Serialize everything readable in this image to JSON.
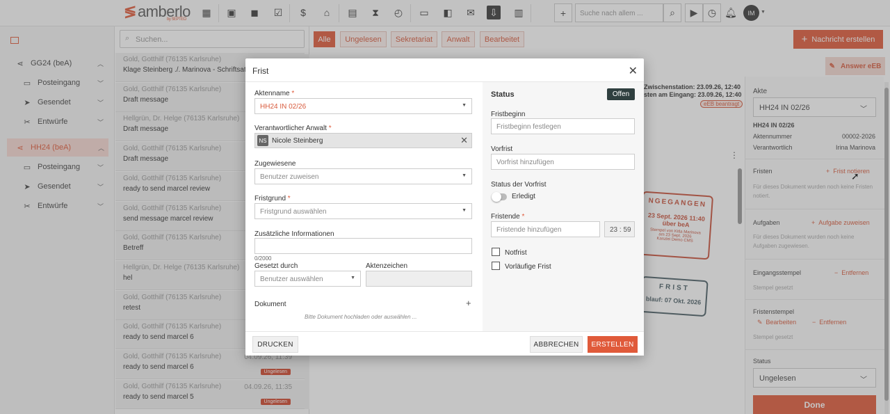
{
  "topbar": {
    "logo": "amberlo",
    "logo_sub": "by SEPTEO",
    "search_placeholder": "Suche nach allem ...",
    "avatar": "IM"
  },
  "nav": {
    "items": [
      {
        "label": "GG24 (beA)",
        "icon": "share-icon"
      },
      {
        "label": "Posteingang",
        "icon": "inbox-icon"
      },
      {
        "label": "Gesendet",
        "icon": "send-icon"
      },
      {
        "label": "Entwürfe",
        "icon": "draft-icon"
      },
      {
        "label": "HH24 (beA)",
        "icon": "share-icon"
      },
      {
        "label": "Posteingang",
        "icon": "inbox-icon"
      },
      {
        "label": "Gesendet",
        "icon": "send-icon"
      },
      {
        "label": "Entwürfe",
        "icon": "draft-icon"
      }
    ]
  },
  "list": {
    "search_placeholder": "Suchen...",
    "messages": [
      {
        "from": "Gold, Gotthilf (76135 Karlsruhe)",
        "subject": "Klage Steinberg ./. Marinova - Schriftsatz",
        "date": "",
        "badge": ""
      },
      {
        "from": "Gold, Gotthilf (76135 Karlsruhe)",
        "subject": "Draft message",
        "date": "",
        "badge": ""
      },
      {
        "from": "Hellgrün, Dr. Helge (76135 Karlsruhe)",
        "subject": "Draft message",
        "date": "",
        "badge": ""
      },
      {
        "from": "Gold, Gotthilf (76135 Karlsruhe)",
        "subject": "Draft message",
        "date": "",
        "badge": ""
      },
      {
        "from": "Gold, Gotthilf (76135 Karlsruhe)",
        "subject": "ready to send marcel review",
        "date": "",
        "badge": ""
      },
      {
        "from": "Gold, Gotthilf (76135 Karlsruhe)",
        "subject": "send message marcel review",
        "date": "",
        "badge": ""
      },
      {
        "from": "Gold, Gotthilf (76135 Karlsruhe)",
        "subject": "Betreff",
        "date": "",
        "badge": ""
      },
      {
        "from": "Hellgrün, Dr. Helge (76135 Karlsruhe)",
        "subject": "hel",
        "date": "",
        "badge": ""
      },
      {
        "from": "Gold, Gotthilf (76135 Karlsruhe)",
        "subject": "retest",
        "date": "",
        "badge": ""
      },
      {
        "from": "Gold, Gotthilf (76135 Karlsruhe)",
        "subject": "ready to send marcel 6",
        "date": "",
        "badge": ""
      },
      {
        "from": "Gold, Gotthilf (76135 Karlsruhe)",
        "subject": "ready to send marcel 6",
        "date": "04.09.26, 11:39",
        "badge": "Ungelesen"
      },
      {
        "from": "Gold, Gotthilf (76135 Karlsruhe)",
        "subject": "ready to send marcel 5",
        "date": "04.09.26, 11:35",
        "badge": "Ungelesen"
      }
    ]
  },
  "filters": [
    "Alle",
    "Ungelesen",
    "Sekretariat",
    "Anwalt",
    "Bearbeitet"
  ],
  "create_button": "Nachricht erstellen",
  "answer_button": "Answer eEB",
  "detail": {
    "zwischenstation": "Zwischenstation: 23.09.26, 12:40",
    "eingang": "sten am Eingang: 23.09.26, 12:40",
    "eeb_badge": "eEB beantragt",
    "stamp1_title": "NGEGANGEN",
    "stamp1_date": "23 Sept. 2026 11:40",
    "stamp1_sub": "über beA",
    "stamp1_line1": "Stempel von Kitla Marinova",
    "stamp1_line2": "am 23 Sept. 2026",
    "stamp1_line3": "Kanzlei Demo CMS",
    "stamp2_title": "FRIST",
    "stamp2_sub": "blauf: 07 Okt. 2026"
  },
  "rpanel": {
    "akte_label": "Akte",
    "akte_value": "HH24 IN 02/26",
    "akte_title": "HH24 IN 02/26",
    "aktennummer_label": "Aktennummer",
    "aktennummer_value": "00002-2026",
    "verantwortlich_label": "Verantwortlich",
    "verantwortlich_value": "Irina Marinova",
    "fristen_label": "Fristen",
    "fristen_link": "Frist notieren",
    "fristen_text": "Für dieses Dokument wurden noch keine Fristen notiert.",
    "aufgaben_label": "Aufgaben",
    "aufgaben_link": "Aufgabe zuweisen",
    "aufgaben_text": "Für dieses Dokument wurden noch keine Aufgaben zugewiesen.",
    "eingangsstempel_label": "Eingangsstempel",
    "eingangsstempel_link": "Entfernen",
    "eingangsstempel_text": "Stempel gesetzt",
    "fristenstempel_label": "Fristenstempel",
    "fristenstempel_edit": "Bearbeiten",
    "fristenstempel_remove": "Entfernen",
    "fristenstempel_text": "Stempel gesetzt",
    "status_label": "Status",
    "status_value": "Ungelesen",
    "done_button": "Done"
  },
  "dialog": {
    "title": "Frist",
    "aktenname_label": "Aktenname",
    "aktenname_value": "HH24 IN 02/26",
    "anwalt_label": "Verantwortlicher Anwalt",
    "anwalt_initials": "NS",
    "anwalt_value": "Nicole Steinberg",
    "zugewiesene_label": "Zugewiesene",
    "zugewiesene_placeholder": "Benutzer zuweisen",
    "fristgrund_label": "Fristgrund",
    "fristgrund_placeholder": "Fristgrund auswählen",
    "zusatz_label": "Zusätzliche Informationen",
    "zusatz_counter": "0/2000",
    "gesetzt_label": "Gesetzt durch",
    "gesetzt_placeholder": "Benutzer auswählen",
    "aktenzeichen_label": "Aktenzeichen",
    "dokument_label": "Dokument",
    "dokument_hint": "Bitte Dokument hochladen oder auswählen ...",
    "status_title": "Status",
    "status_badge": "Offen",
    "fristbeginn_label": "Fristbeginn",
    "fristbeginn_placeholder": "Fristbeginn festlegen",
    "vorfrist_label": "Vorfrist",
    "vorfrist_placeholder": "Vorfrist hinzufügen",
    "status_vorfrist_label": "Status der Vorfrist",
    "erledigt_label": "Erledigt",
    "fristende_label": "Fristende",
    "fristende_placeholder": "Fristende hinzufügen",
    "time_h": "23",
    "time_m": "59",
    "notfrist_label": "Notfrist",
    "vorlaeufig_label": "Vorläufige Frist",
    "drucken_button": "DRUCKEN",
    "abbrechen_button": "ABBRECHEN",
    "erstellen_button": "ERSTELLEN"
  }
}
